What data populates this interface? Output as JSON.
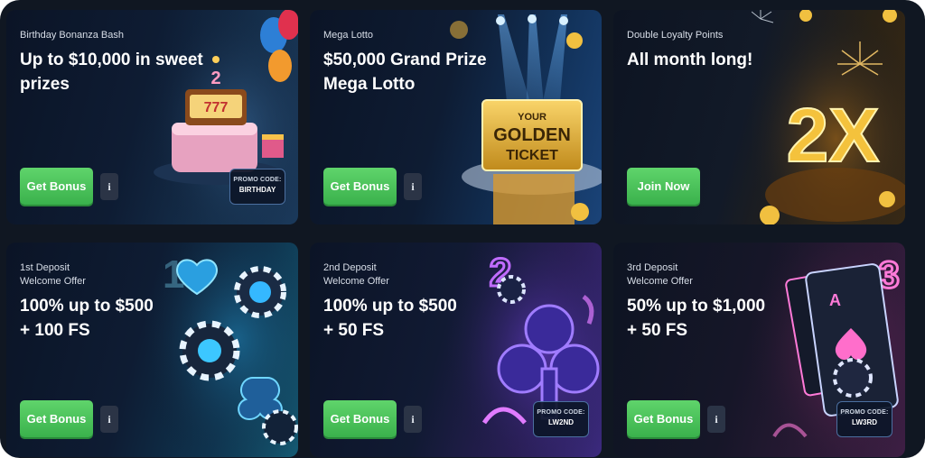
{
  "cards": [
    {
      "subtitle": [
        "Birthday Bonanza Bash"
      ],
      "headline": [
        "Up to $10,000 in sweet",
        "prizes"
      ],
      "cta": "Get Bonus",
      "info": "i",
      "promo": {
        "label": "PROMO CODE:",
        "code": "BIRTHDAY"
      },
      "art_icon": "birthday-cake-icon",
      "art_text": [
        "2",
        "777"
      ]
    },
    {
      "subtitle": [
        "Mega Lotto"
      ],
      "headline": [
        "$50,000 Grand Prize",
        "Mega Lotto"
      ],
      "cta": "Get Bonus",
      "info": "i",
      "art_icon": "golden-ticket-icon",
      "art_text": [
        "YOUR",
        "GOLDEN",
        "TICKET"
      ]
    },
    {
      "subtitle": [
        "Double Loyalty Points"
      ],
      "headline": [
        "All month long!"
      ],
      "cta": "Join Now",
      "art_icon": "2x-multiplier-icon",
      "art_text": [
        "2X"
      ]
    },
    {
      "subtitle": [
        "1st Deposit",
        "Welcome Offer"
      ],
      "headline": [
        "100% up to $500",
        "+ 100 FS"
      ],
      "cta": "Get Bonus",
      "info": "i",
      "art_icon": "poker-chips-icon"
    },
    {
      "subtitle": [
        "2nd Deposit",
        "Welcome Offer"
      ],
      "headline": [
        "100% up to $500",
        "+ 50 FS"
      ],
      "cta": "Get Bonus",
      "info": "i",
      "promo": {
        "label": "PROMO CODE:",
        "code": "LW2ND"
      },
      "art_icon": "neon-club-icon",
      "art_text": [
        "2"
      ]
    },
    {
      "subtitle": [
        "3rd Deposit",
        "Welcome Offer"
      ],
      "headline": [
        "50% up to $1,000",
        "+ 50 FS"
      ],
      "cta": "Get Bonus",
      "info": "i",
      "promo": {
        "label": "PROMO CODE:",
        "code": "LW3RD"
      },
      "art_icon": "playing-cards-icon",
      "art_text": [
        "3"
      ]
    }
  ],
  "colors": {
    "frame_bg": "#101722",
    "cta_green": "#47c35a",
    "text_primary": "#ffffff",
    "text_secondary": "#d8dee8",
    "promo_border": "#4b6fa0"
  }
}
